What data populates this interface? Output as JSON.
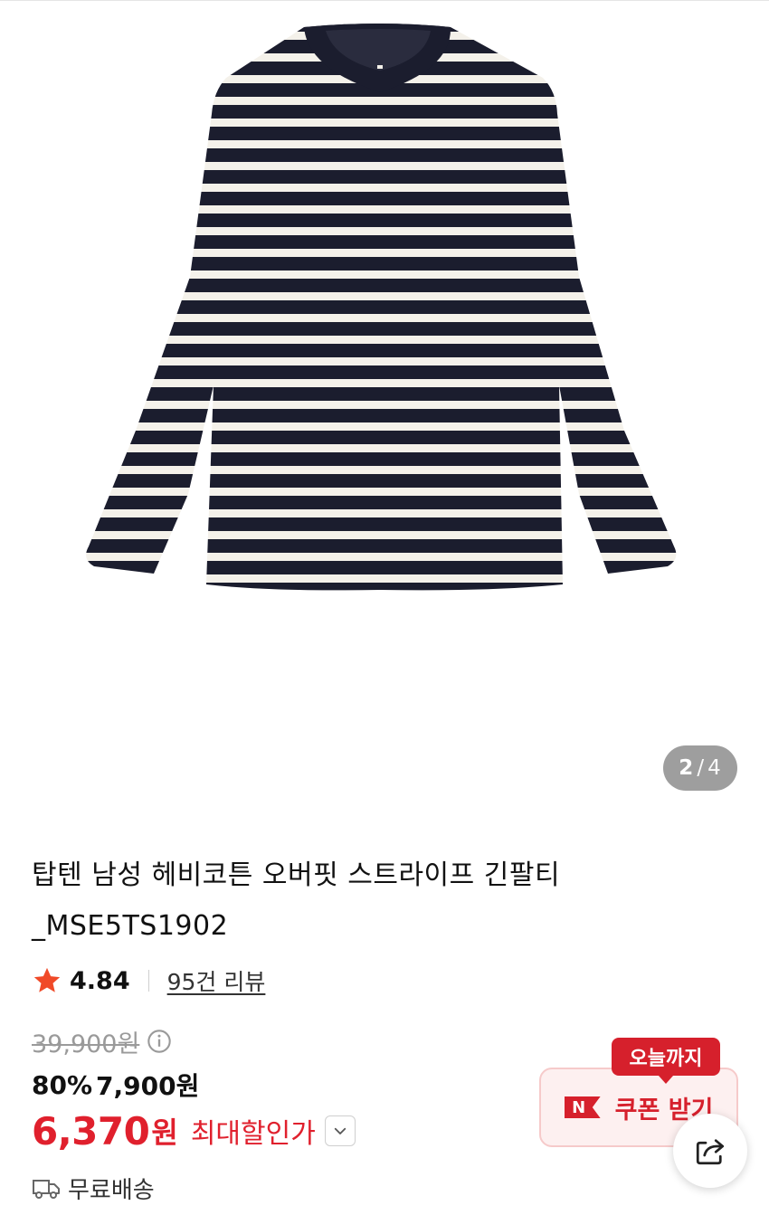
{
  "gallery": {
    "image_alt": "striped long sleeve t-shirt",
    "current": "2",
    "separator": "/",
    "total": "4"
  },
  "product": {
    "title": "탑텐 남성 헤비코튼 오버핏 스트라이프 긴팔티_MSE5TS1902",
    "rating": "4.84",
    "review_link": "95건 리뷰",
    "original_price": "39,900원",
    "sale_percent": "80%",
    "sale_price": "7,900원",
    "final_price": "6,370",
    "final_unit": "원",
    "final_label": "최대할인가",
    "shipping": "무료배송"
  },
  "coupon": {
    "badge": "오늘까지",
    "n_mark": "N",
    "label": "쿠폰 받기"
  },
  "icons": {
    "star": "star-icon",
    "info": "info-icon",
    "chevron": "chevron-down-icon",
    "truck": "truck-icon",
    "share": "share-icon"
  },
  "colors": {
    "accent_red": "#e0202d",
    "star_orange": "#f04a28",
    "stripe_navy": "#1b1d2e",
    "stripe_cream": "#f4f1ea"
  }
}
